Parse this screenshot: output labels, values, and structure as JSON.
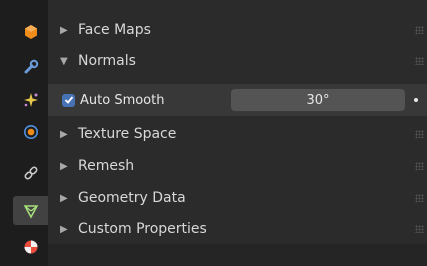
{
  "tabs": [
    {
      "icon": "object-icon"
    },
    {
      "icon": "wrench-icon"
    },
    {
      "icon": "particles-icon"
    },
    {
      "icon": "physics-icon"
    },
    {
      "icon": "constraints-icon"
    },
    {
      "icon": "mesh-data-icon"
    },
    {
      "icon": "material-icon"
    }
  ],
  "panels": {
    "face_maps": "Face Maps",
    "normals": "Normals",
    "texture_space": "Texture Space",
    "remesh": "Remesh",
    "geometry_data": "Geometry Data",
    "custom_properties": "Custom Properties"
  },
  "normals": {
    "auto_smooth_label": "Auto Smooth",
    "auto_smooth_checked": true,
    "angle_value": "30°"
  },
  "colors": {
    "accent": "#4772b3",
    "panel_bg": "#2b2b2b",
    "tabbar_bg": "#1d1d1d"
  }
}
